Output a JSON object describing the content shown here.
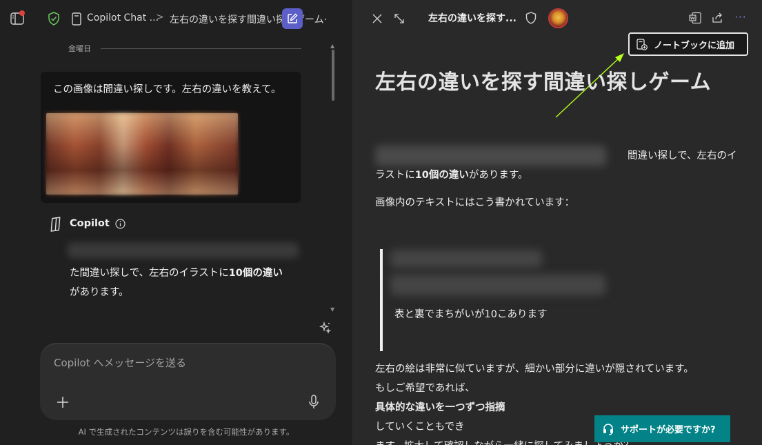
{
  "left_pane": {
    "breadcrumb": {
      "item1": "Copilot Chat ...",
      "separator": ">",
      "item2": "左右の違いを探す間違い探しゲーム·"
    },
    "date_label": "金曜日",
    "user_message": "この画像は間違い探しです。左右の違いを教えて。",
    "assistant": {
      "name": "Copilot",
      "reply_part1": "た間違い探しで、左右のイラストに",
      "reply_bold": "10個の違い",
      "reply_part2": "があります。"
    },
    "composer": {
      "placeholder": "Copilot へメッセージを送る",
      "plus_label": "+"
    },
    "disclaimer": "AI で生成されたコンテンツは誤りを含む可能性があります。"
  },
  "right_pane": {
    "header_title": "左右の違いを探す...",
    "more_label": "···",
    "tooltip": "ノートブックに追加",
    "doc_title": "左右の違いを探す間違い探しゲーム",
    "para1_line1": "間違い探しで、左右のイ",
    "para1_line2_pre": "ラストに",
    "para1_line2_bold": "10個の違い",
    "para1_line2_post": "があります。",
    "para2": "画像内のテキストにはこう書かれています：",
    "quote_text": "表と裏でまちがいが10こあります",
    "para3_line1": "左右の絵は非常に似ていますが、細かい部分に違いが隠されています。",
    "para3_line2_pre": "もしご希望であれば、",
    "para3_line2_bold": "具体的な違いを一つずつ指摘",
    "para3_line2_post": "していくこともでき",
    "para3_line3": "ます。拡大して確認しながら一緒に探してみましょうか？",
    "support_button": "サポートが必要ですか?"
  },
  "colors": {
    "accent": "#5b5fc7",
    "support_teal": "#038387",
    "arrow_annotation": "#b5ff1a",
    "notification": "#e0413c"
  },
  "icons": [
    "sidebar-icon",
    "shield-check-icon",
    "notebook-icon",
    "compose-icon",
    "copilot-logo-icon",
    "info-icon",
    "sparkle-icon",
    "plus-icon",
    "mic-icon",
    "close-icon",
    "expand-icon",
    "shield-icon",
    "avatar",
    "word-icon",
    "share-icon",
    "more-icon",
    "notebook-add-icon",
    "headset-icon"
  ]
}
